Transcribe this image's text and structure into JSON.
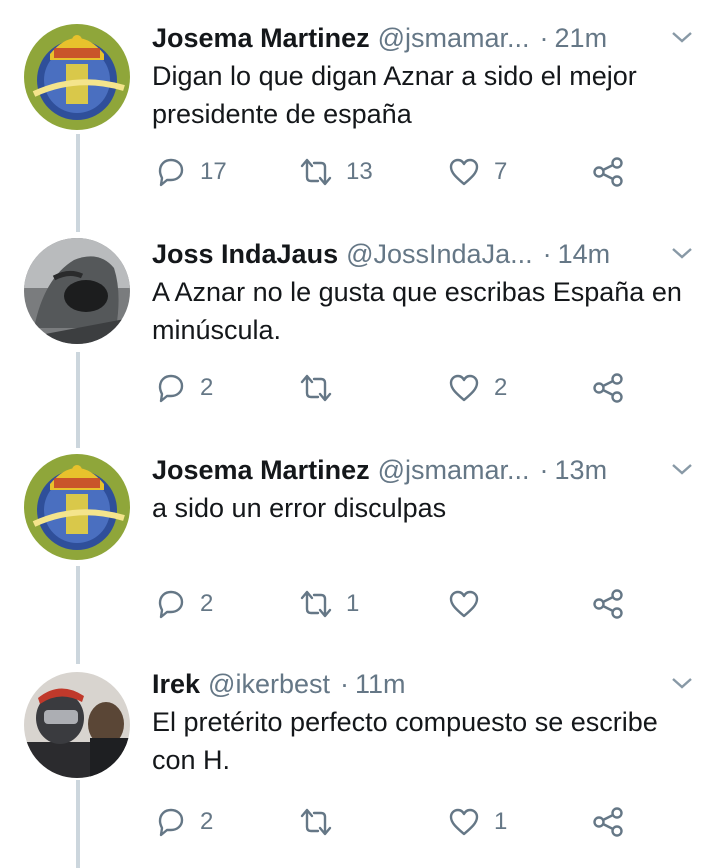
{
  "colors": {
    "text": "#14171a",
    "secondary": "#657786",
    "thread_line": "#ccd6dd",
    "background": "#ffffff"
  },
  "icons": {
    "reply": "reply-icon",
    "retweet": "retweet-icon",
    "like": "heart-icon",
    "share": "share-icon",
    "menu": "chevron-down-icon"
  },
  "tweets": [
    {
      "name": "Josema Martinez",
      "handle": "@jsmamar...",
      "separator": "·",
      "time": "21m",
      "text": "Digan lo que digan  Aznar a sido el mejor presidente de españa",
      "replies": "17",
      "retweets": "13",
      "likes": "7"
    },
    {
      "name": "Joss IndaJaus",
      "handle": "@JossIndaJa...",
      "separator": "·",
      "time": "14m",
      "text": "A Aznar no le gusta que escribas España en minúscula.",
      "replies": "2",
      "retweets": "",
      "likes": "2"
    },
    {
      "name": "Josema Martinez",
      "handle": "@jsmamar...",
      "separator": "·",
      "time": "13m",
      "text": "a sido un error disculpas",
      "replies": "2",
      "retweets": "1",
      "likes": ""
    },
    {
      "name": "Irek",
      "handle": "@ikerbest",
      "separator": "·",
      "time": "11m",
      "text": "El pretérito perfecto compuesto se escribe con H.",
      "replies": "2",
      "retweets": "",
      "likes": "1"
    }
  ]
}
